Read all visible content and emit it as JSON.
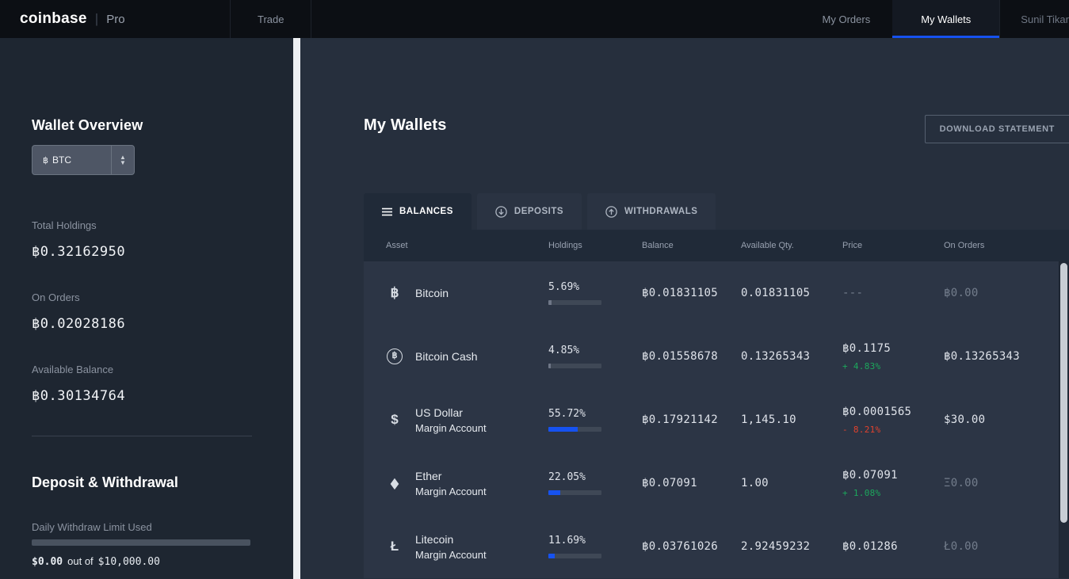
{
  "colors": {
    "accent_blue": "#1652f0",
    "positive_green": "#1ca75c",
    "negative_red": "#e2422d",
    "bar_gray": "#6e7686"
  },
  "nav": {
    "logo": "coinbase",
    "logo_divider": "|",
    "logo_suffix": "Pro",
    "items": {
      "trade": "Trade",
      "my_orders": "My Orders",
      "my_wallets": "My Wallets",
      "user": "Sunil Tikar"
    }
  },
  "sidebar": {
    "overview_title": "Wallet Overview",
    "currency": {
      "symbol": "฿",
      "code": "BTC"
    },
    "stats": [
      {
        "label": "Total Holdings",
        "value": "฿0.32162950"
      },
      {
        "label": "On Orders",
        "value": "฿0.02028186"
      },
      {
        "label": "Available Balance",
        "value": "฿0.30134764"
      }
    ],
    "deposit_title": "Deposit & Withdrawal",
    "limit": {
      "label": "Daily Withdraw Limit Used",
      "used": "$0.00",
      "separator": "out of",
      "total": "$10,000.00",
      "percent_used": 0
    }
  },
  "main": {
    "title": "My Wallets",
    "download_button": "DOWNLOAD STATEMENT",
    "tabs": [
      {
        "label": "BALANCES",
        "active": true
      },
      {
        "label": "DEPOSITS",
        "active": false
      },
      {
        "label": "WITHDRAWALS",
        "active": false
      }
    ],
    "table": {
      "headers": [
        "Asset",
        "Holdings",
        "Balance",
        "Available Qty.",
        "Price",
        "On Orders"
      ],
      "rows": [
        {
          "symbol": "฿",
          "name": "Bitcoin",
          "subtitle": "",
          "holdings_pct": "5.69%",
          "holdings_value": 5.69,
          "bar_color": "#6e7686",
          "balance": "฿0.01831105",
          "available": "0.01831105",
          "price": "---",
          "price_class": "dim",
          "change": "",
          "change_class": "",
          "on_orders": "฿0.00",
          "on_orders_class": "dim"
        },
        {
          "symbol": "฿",
          "name": "Bitcoin Cash",
          "subtitle": "",
          "holdings_pct": "4.85%",
          "holdings_value": 4.85,
          "bar_color": "#6e7686",
          "balance": "฿0.01558678",
          "available": "0.13265343",
          "price": "฿0.1175",
          "price_class": "",
          "change": "+ 4.83%",
          "change_class": "up",
          "on_orders": "฿0.13265343",
          "on_orders_class": ""
        },
        {
          "symbol": "$",
          "name": "US Dollar",
          "subtitle": "Margin Account",
          "holdings_pct": "55.72%",
          "holdings_value": 55.72,
          "bar_color": "#1652f0",
          "balance": "฿0.17921142",
          "available": "1,145.10",
          "price": "฿0.0001565",
          "price_class": "",
          "change": "- 8.21%",
          "change_class": "down",
          "on_orders": "$30.00",
          "on_orders_class": ""
        },
        {
          "symbol": "◆",
          "name": "Ether",
          "subtitle": "Margin Account",
          "holdings_pct": "22.05%",
          "holdings_value": 22.05,
          "bar_color": "#1652f0",
          "balance": "฿0.07091",
          "available": "1.00",
          "price": "฿0.07091",
          "price_class": "",
          "change": "+ 1.08%",
          "change_class": "up",
          "on_orders": "Ξ0.00",
          "on_orders_class": "dim"
        },
        {
          "symbol": "Ł",
          "name": "Litecoin",
          "subtitle": "Margin Account",
          "holdings_pct": "11.69%",
          "holdings_value": 11.69,
          "bar_color": "#1652f0",
          "balance": "฿0.03761026",
          "available": "2.92459232",
          "price": "฿0.01286",
          "price_class": "",
          "change": "",
          "change_class": "",
          "on_orders": "Ł0.00",
          "on_orders_class": "dim"
        }
      ]
    }
  }
}
